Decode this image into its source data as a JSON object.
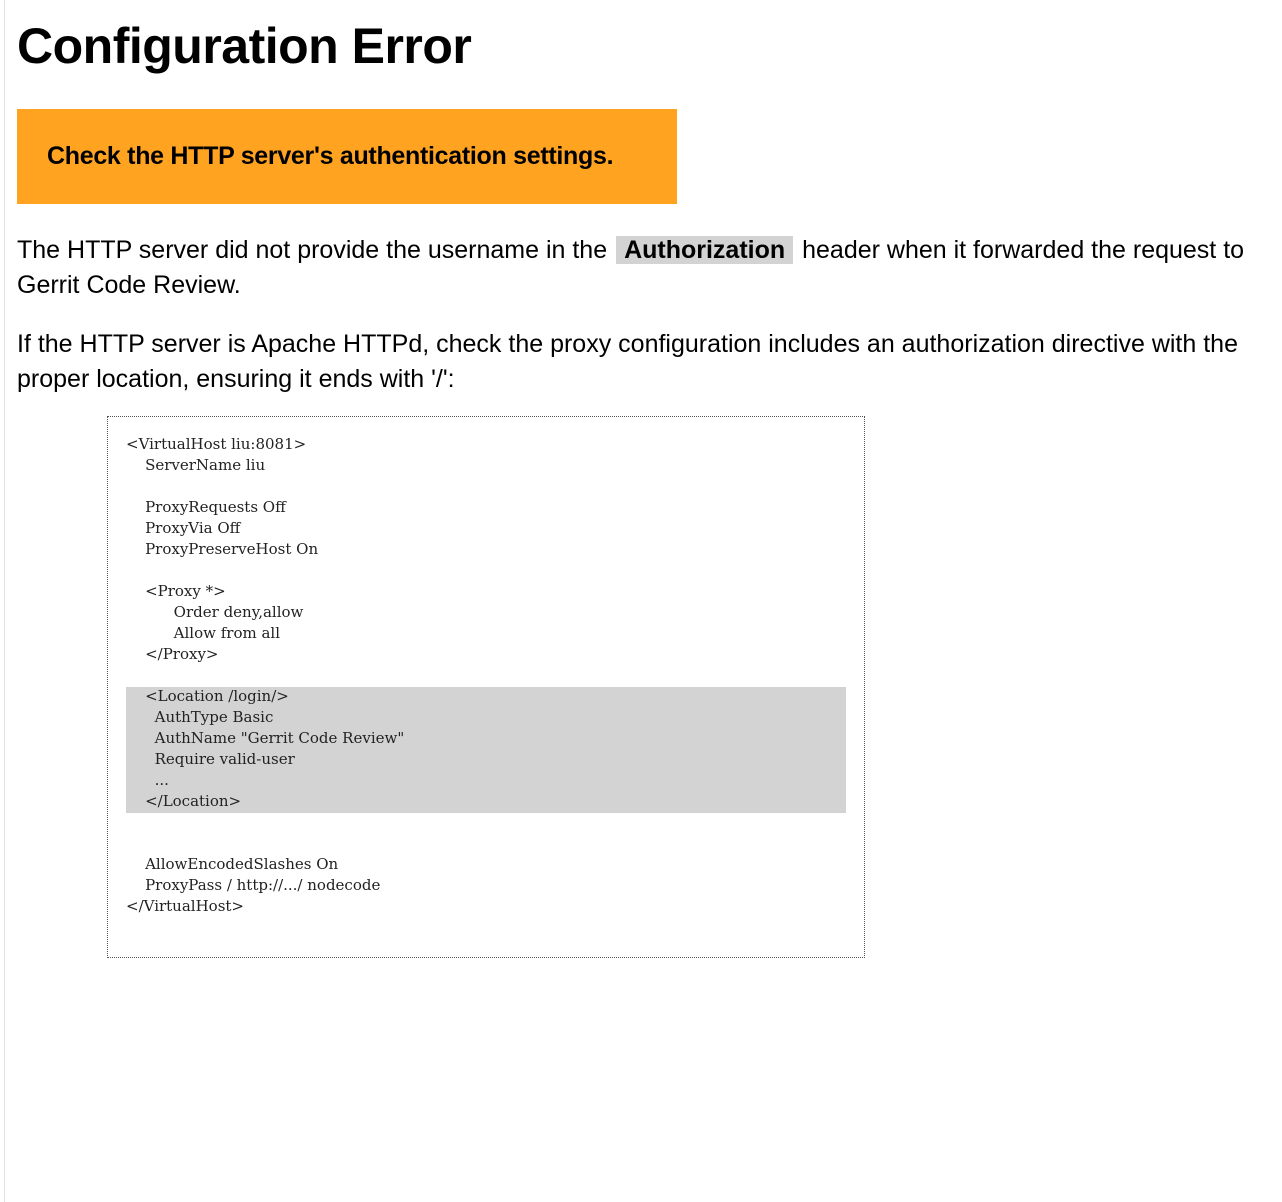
{
  "page": {
    "title": "Configuration Error",
    "banner": "Check the HTTP server's authentication settings.",
    "paragraph1": {
      "before": "The HTTP server did not provide the username in the ",
      "code": "Authorization",
      "after": " header when it forwarded the request to Gerrit Code Review."
    },
    "paragraph2": "If the HTTP server is Apache HTTPd, check the proxy configuration includes an authorization directive with the proper location, ensuring it ends with '/':"
  },
  "config_sample": {
    "lines": [
      "<VirtualHost liu:8081>",
      "    ServerName liu",
      "",
      "    ProxyRequests Off",
      "    ProxyVia Off",
      "    ProxyPreserveHost On",
      "",
      "    <Proxy *>",
      "          Order deny,allow",
      "          Allow from all",
      "    </Proxy>",
      "",
      "    <Location /login/>",
      "      AuthType Basic",
      "      AuthName \"Gerrit Code Review\"",
      "      Require valid-user",
      "      ...",
      "    </Location>",
      "",
      "",
      "    AllowEncodedSlashes On",
      "    ProxyPass / http://.../ nodecode",
      "</VirtualHost>"
    ]
  }
}
